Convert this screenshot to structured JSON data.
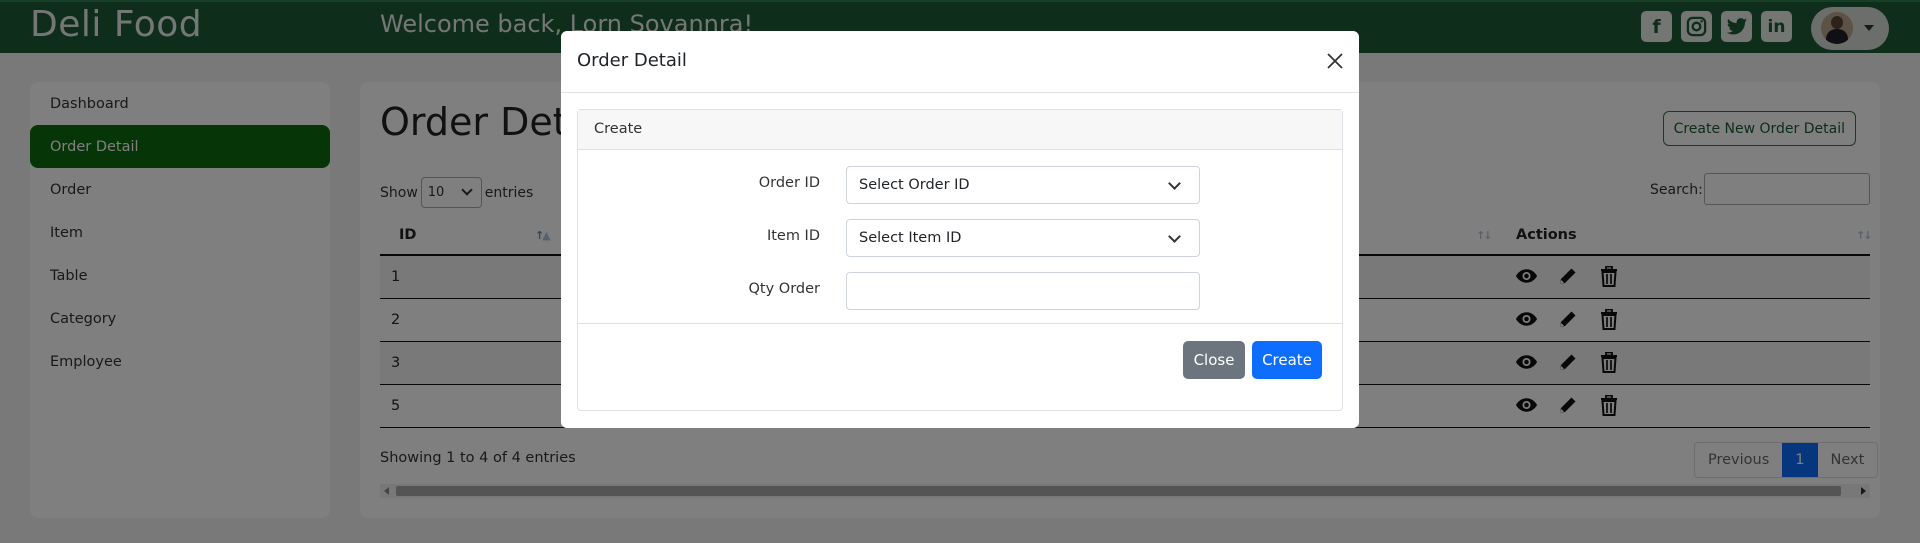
{
  "header": {
    "brand": "Deli Food",
    "welcome": "Welcome back, Lorn Sovannra!",
    "social_icons": [
      "facebook-icon",
      "instagram-icon",
      "twitter-icon",
      "linkedin-icon"
    ]
  },
  "sidebar": {
    "items": [
      {
        "label": "Dashboard"
      },
      {
        "label": "Order Detail",
        "active": true
      },
      {
        "label": "Order"
      },
      {
        "label": "Item"
      },
      {
        "label": "Table"
      },
      {
        "label": "Category"
      },
      {
        "label": "Employee"
      }
    ]
  },
  "main": {
    "title": "Order Detail",
    "create_button": "Create New Order Detail",
    "show_label": "Show",
    "entries_value": "10",
    "entries_label": "entries",
    "search_label": "Search:",
    "columns": {
      "id": "ID",
      "actions": "Actions"
    },
    "rows": [
      {
        "id": "1"
      },
      {
        "id": "2"
      },
      {
        "id": "3"
      },
      {
        "id": "5"
      }
    ],
    "footer_info": "Showing 1 to 4 of 4 entries",
    "pagination": {
      "previous": "Previous",
      "current": "1",
      "next": "Next"
    }
  },
  "modal": {
    "title": "Order Detail",
    "card_title": "Create",
    "fields": {
      "order_id": {
        "label": "Order ID",
        "value": "Select Order ID"
      },
      "item_id": {
        "label": "Item ID",
        "value": "Select Item ID"
      },
      "qty": {
        "label": "Qty Order",
        "value": ""
      }
    },
    "close_button": "Close",
    "create_button": "Create"
  },
  "colors": {
    "header_bg": "#1d5b36",
    "sidebar_active": "#0c6b0f",
    "primary": "#0d6efd",
    "secondary": "#6c757d"
  }
}
